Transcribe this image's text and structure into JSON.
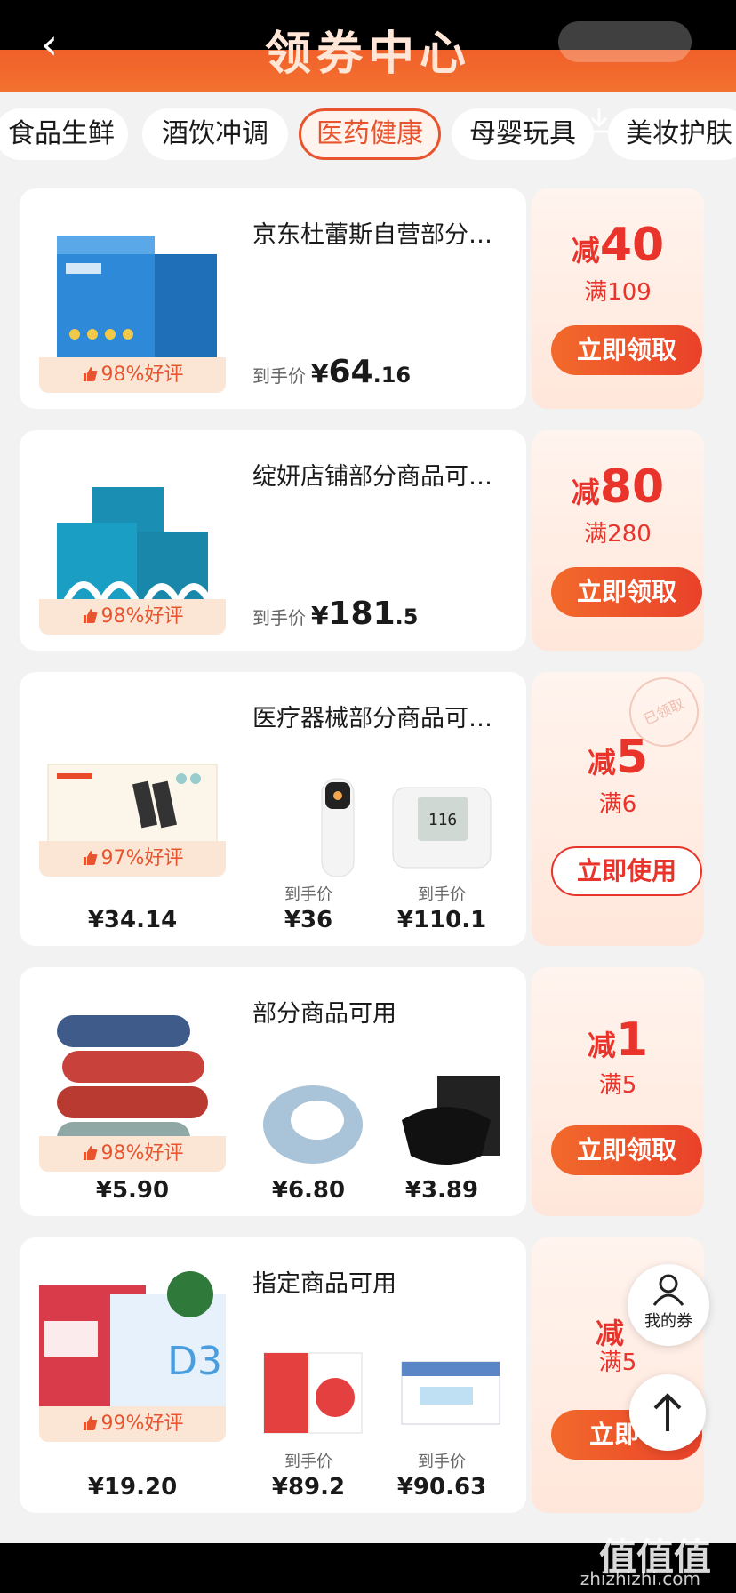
{
  "header": {
    "title": "领券中心"
  },
  "tabs": [
    "食品生鲜",
    "酒饮冲调",
    "医药健康",
    "母婴玩具",
    "美妆护肤"
  ],
  "active_tab": "医药健康",
  "coupons": [
    {
      "shop": "京东杜蕾斯自营部分…",
      "rating": "98%好评",
      "price_label": "到手价",
      "price_yen": "¥",
      "price_int": "64",
      "price_dec": ".16",
      "discount_prefix": "减",
      "discount": "40",
      "condition": "满109",
      "button": "立即领取"
    },
    {
      "shop": "绽妍店铺部分商品可…",
      "rating": "98%好评",
      "price_label": "到手价",
      "price_yen": "¥",
      "price_int": "181",
      "price_dec": ".5",
      "discount_prefix": "减",
      "discount": "80",
      "condition": "满280",
      "button": "立即领取"
    },
    {
      "shop": "医疗器械部分商品可…",
      "rating": "97%好评",
      "discount_prefix": "减",
      "discount": "5",
      "condition": "满6",
      "button": "立即使用",
      "stamp": "已领取",
      "products": [
        {
          "label": "",
          "price": "¥34.14"
        },
        {
          "label": "到手价",
          "price": "¥36"
        },
        {
          "label": "到手价",
          "price": "¥110.1"
        }
      ]
    },
    {
      "shop": "部分商品可用",
      "rating": "98%好评",
      "discount_prefix": "减",
      "discount": "1",
      "condition": "满5",
      "button": "立即领取",
      "products": [
        {
          "label": "",
          "price": "¥5.90"
        },
        {
          "label": "",
          "price": "¥6.80"
        },
        {
          "label": "",
          "price": "¥3.89"
        }
      ]
    },
    {
      "shop": "指定商品可用",
      "rating": "99%好评",
      "discount_prefix": "减",
      "discount": "",
      "condition": "满5",
      "button": "立即领",
      "products": [
        {
          "label": "",
          "price": "¥19.20"
        },
        {
          "label": "到手价",
          "price": "¥89.2"
        },
        {
          "label": "到手价",
          "price": "¥90.63"
        }
      ]
    }
  ],
  "float": {
    "my_coupons": "我的券"
  },
  "watermark": {
    "text": "值值值",
    "url": "zhizhizhi.com"
  },
  "colors": {
    "accent": "#e8342a",
    "header": "#f0602a"
  }
}
